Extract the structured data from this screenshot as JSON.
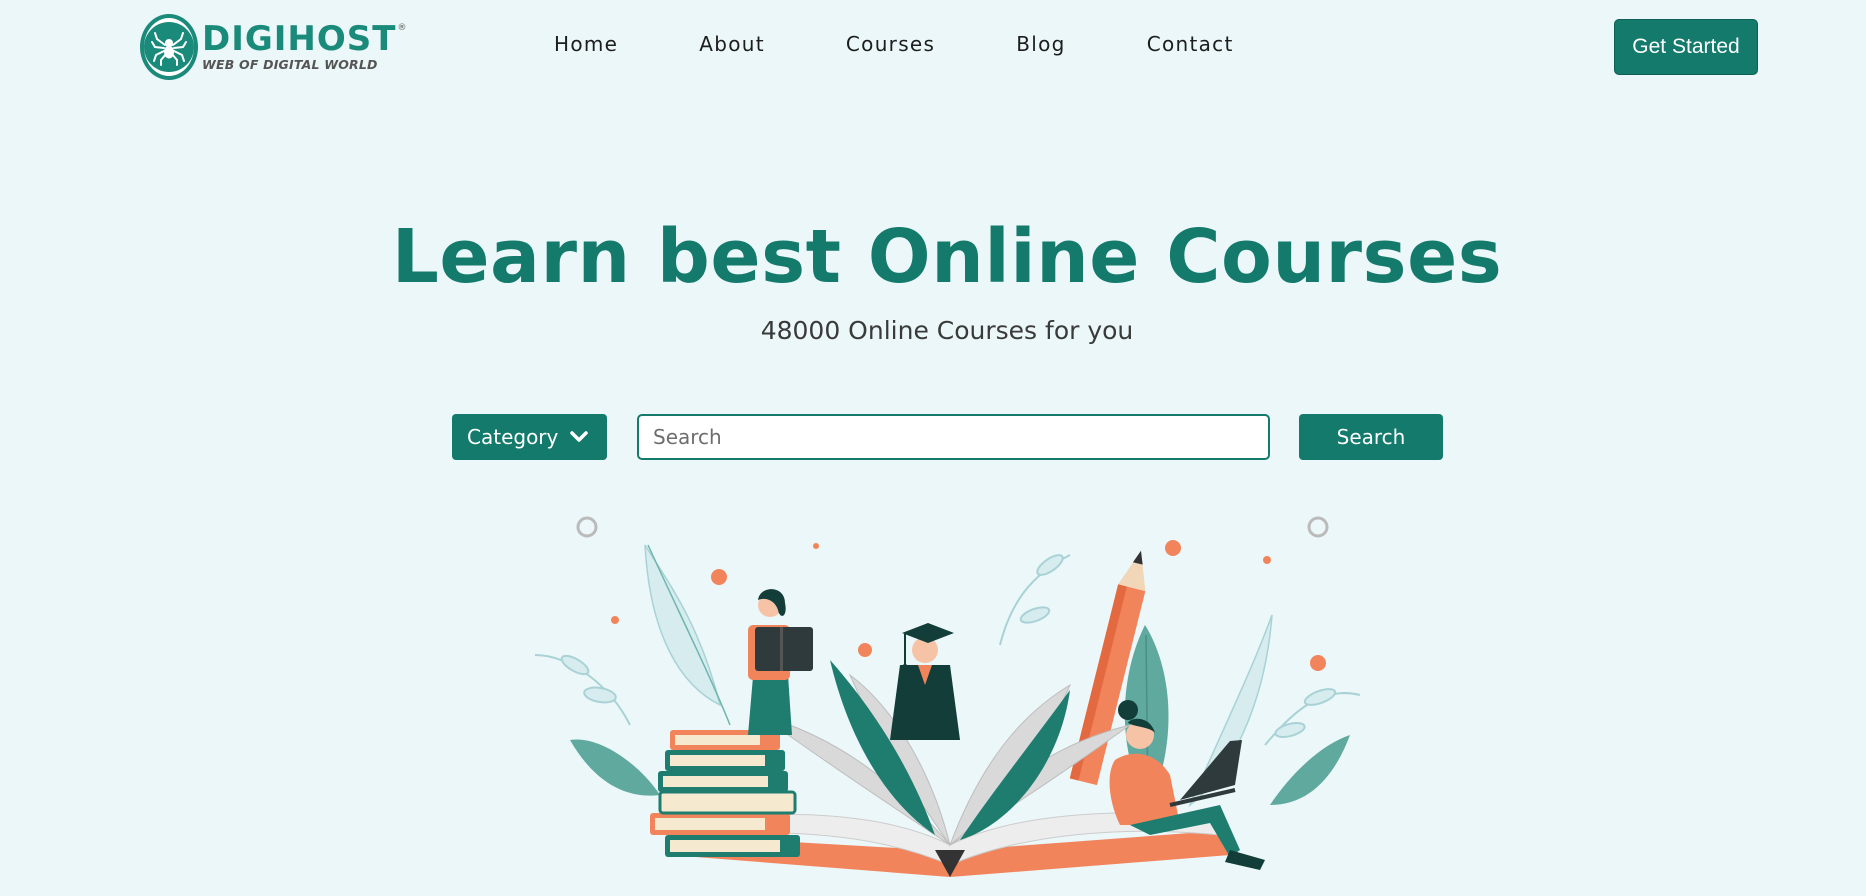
{
  "brand": {
    "name": "DIGIHOST",
    "registered_mark": "®",
    "tagline": "WEB OF DIGITAL WORLD",
    "logo_icon": "spider-icon"
  },
  "nav": {
    "items": [
      {
        "label": "Home"
      },
      {
        "label": "About"
      },
      {
        "label": "Courses"
      },
      {
        "label": "Blog"
      },
      {
        "label": "Contact"
      }
    ]
  },
  "header": {
    "cta_label": "Get Started"
  },
  "hero": {
    "title": "Learn best Online Courses",
    "subtitle": "48000 Online Courses for you"
  },
  "search": {
    "category_label": "Category",
    "category_icon": "chevron-down-icon",
    "placeholder": "Search",
    "value": "",
    "button_label": "Search"
  },
  "colors": {
    "background": "#ebf7f8",
    "primary": "#137a6c",
    "accent": "#f2845c",
    "text": "#1d1d1d"
  },
  "illustration": {
    "icon": "education-illustration"
  }
}
